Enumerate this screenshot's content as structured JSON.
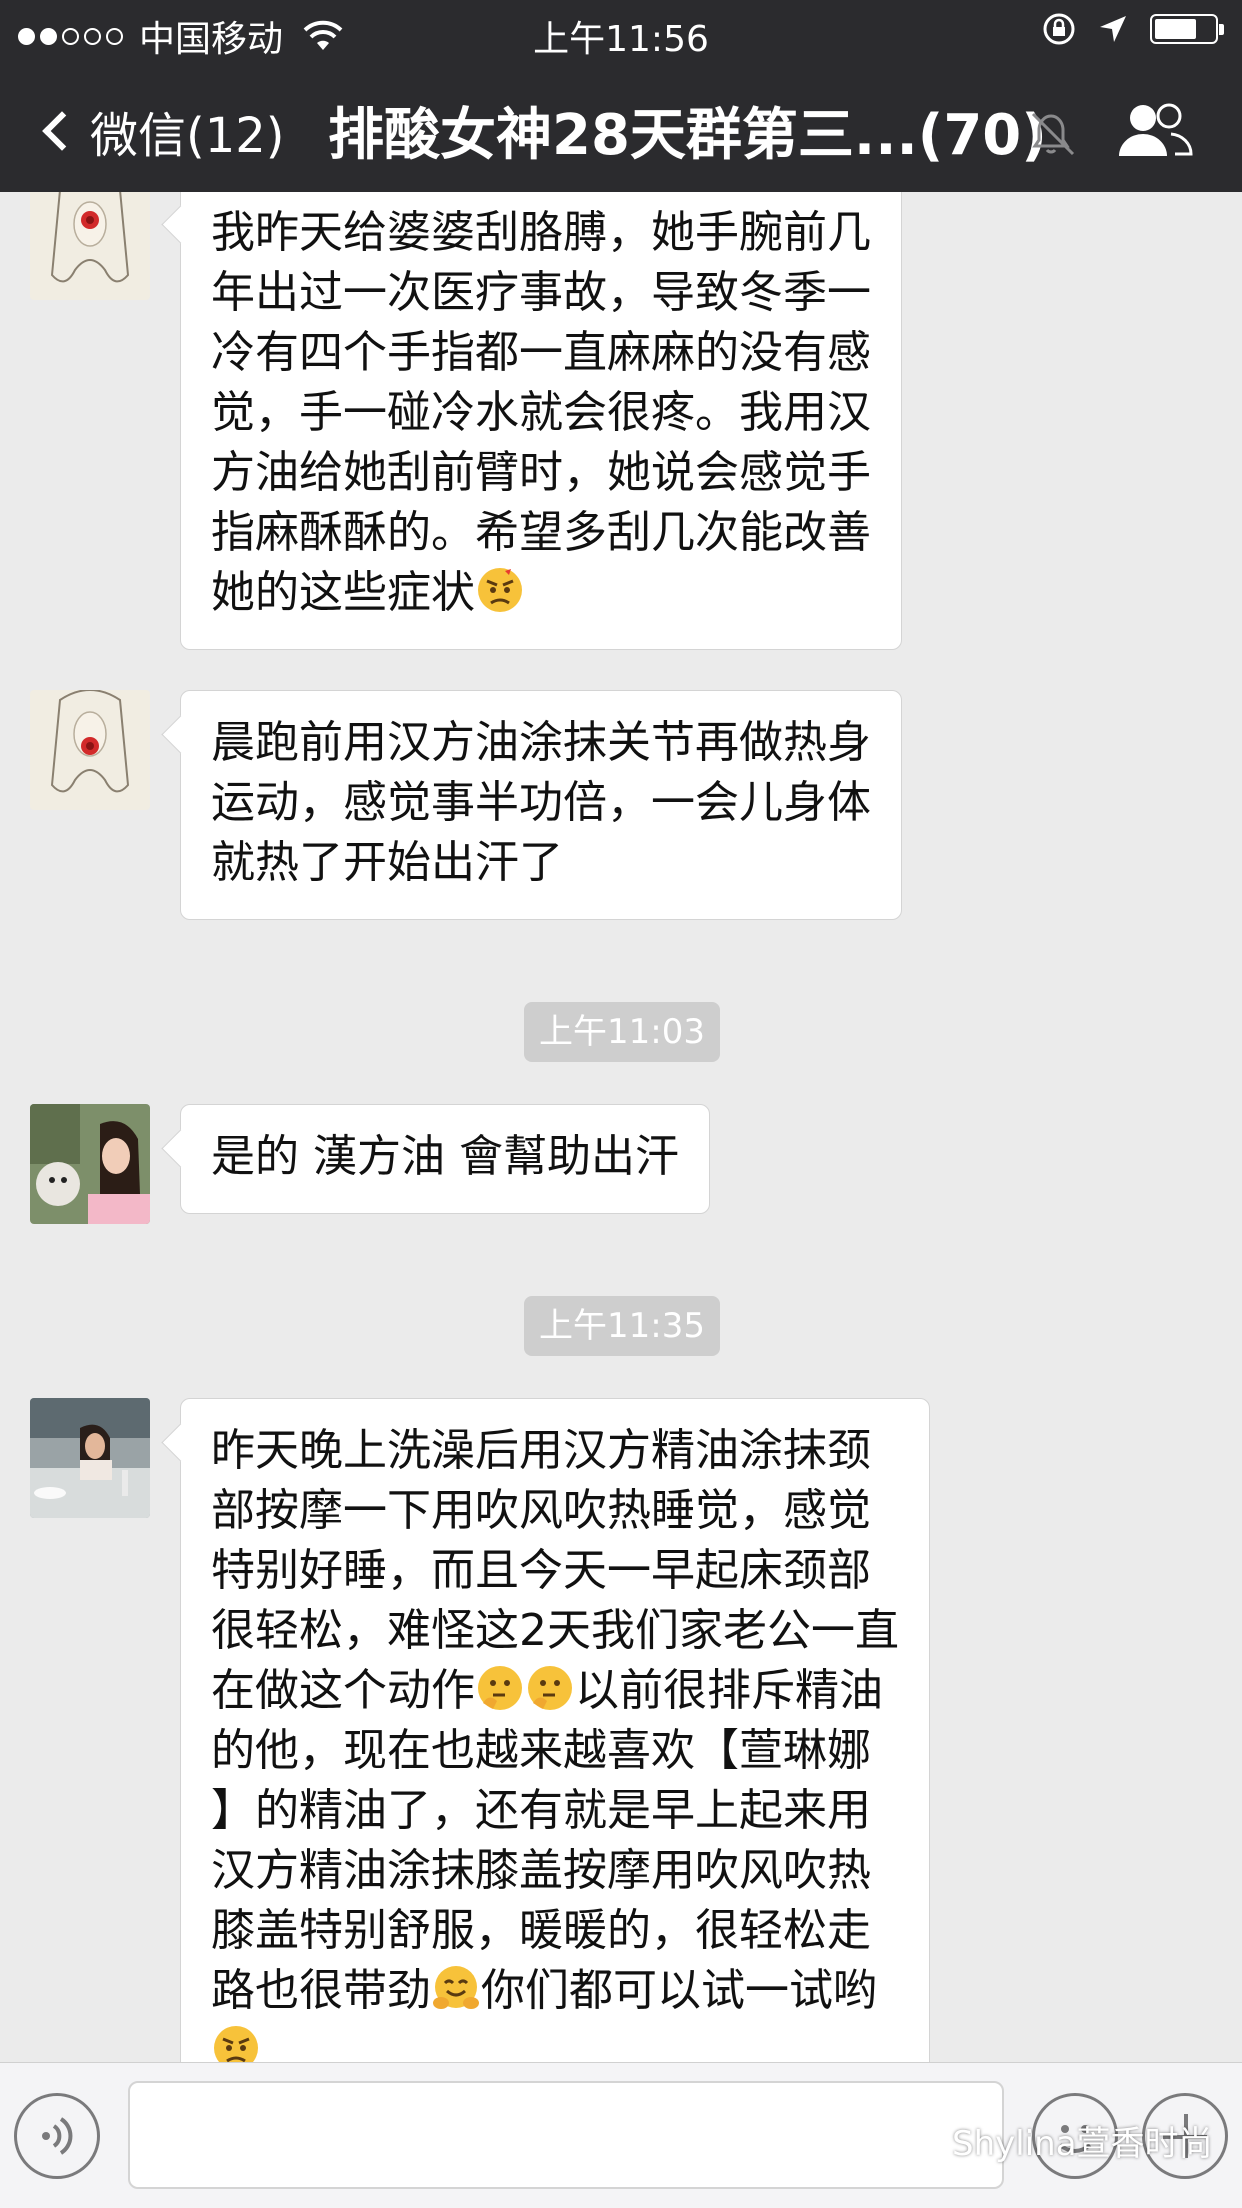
{
  "status_bar": {
    "carrier": "中国移动",
    "time": "上午11:56"
  },
  "nav": {
    "back_label": "微信(12)",
    "title": "排酸女神28天群第三...(70)"
  },
  "messages": [
    {
      "type": "text",
      "lines": [
        "我昨天给婆婆刮胳膊，她手腕前几",
        "年出过一次医疗事故，导致冬季一",
        "冷有四个手指都一直麻麻的没有感",
        "觉，手一碰冷水就会很疼。我用汉",
        "方油给她刮前臂时，她说会感觉手",
        "指麻酥酥的。希望多刮几次能改善",
        "她的这些症状"
      ]
    },
    {
      "type": "text",
      "lines": [
        "晨跑前用汉方油涂抹关节再做热身",
        "运动，感觉事半功倍，一会儿身体",
        "就热了开始出汗了"
      ]
    },
    {
      "type": "time",
      "text": "上午11:03"
    },
    {
      "type": "text",
      "lines": [
        "是的 漢方油 會幫助出汗"
      ]
    },
    {
      "type": "time",
      "text": "上午11:35"
    },
    {
      "type": "text",
      "lines": [
        "昨天晚上洗澡后用汉方精油涂抹颈",
        "部按摩一下用吹风吹热睡觉，感觉",
        "特别好睡，而且今天一早起床颈部",
        "很轻松，难怪这2天我们家老公一直",
        "在做这个动作",
        "以前很排斥精油",
        "的他，现在也越来越喜欢【萱琳娜",
        "】的精油了，还有就是早上起来用",
        "汉方精油涂抹膝盖按摩用吹风吹热",
        "膝盖特别舒服，暖暖的，很轻松走",
        "路也很带劲",
        "你们都可以试一试哟"
      ]
    }
  ],
  "watermark": "Shylina萱香时尚",
  "icons": [
    "back-chevron-icon",
    "mute-icon",
    "group-members-icon",
    "voice-icon",
    "emoji-icon",
    "plus-icon",
    "wechat-logo-icon"
  ]
}
